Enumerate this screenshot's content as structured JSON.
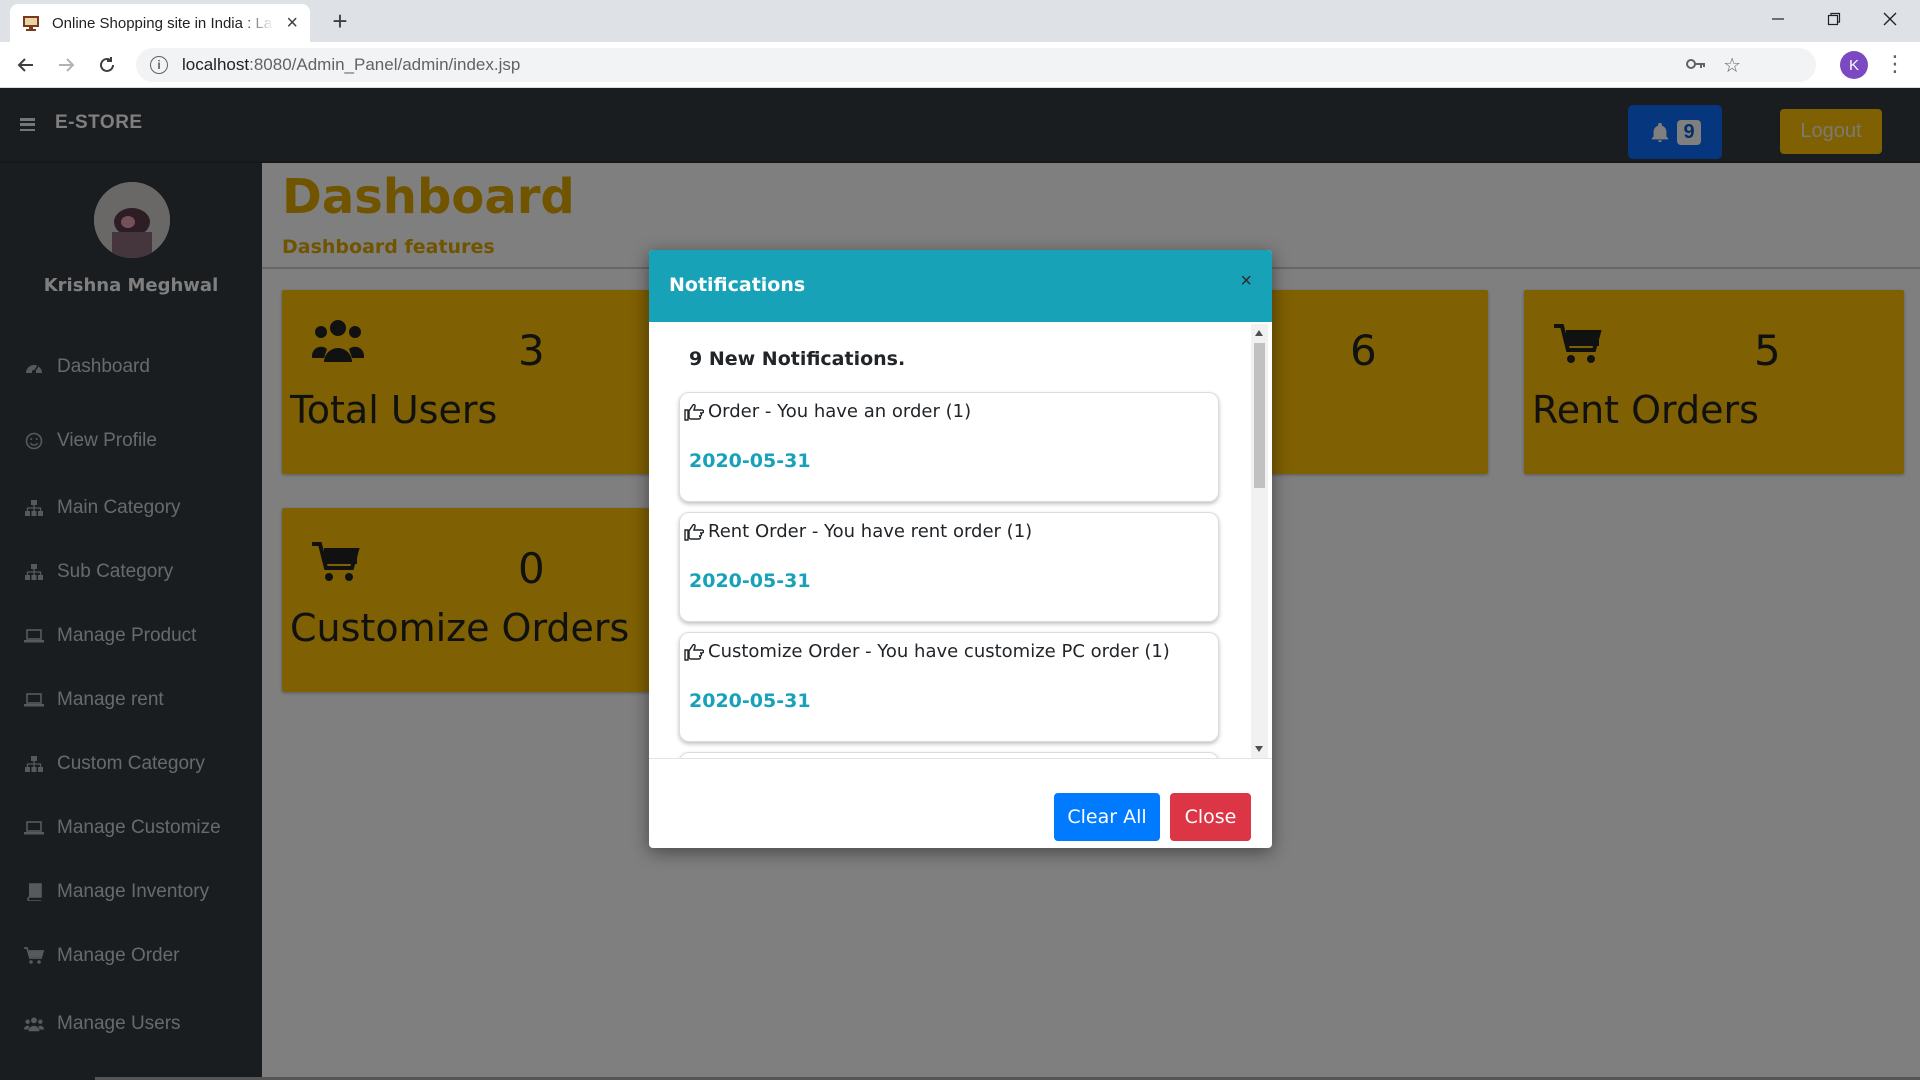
{
  "browser": {
    "tab_title": "Online Shopping site in India : La",
    "url_host": "localhost",
    "url_path": ":8080/Admin_Panel/admin/index.jsp",
    "profile_initial": "K"
  },
  "navbar": {
    "brand": "E-STORE",
    "notification_count": "9",
    "logout_label": "Logout"
  },
  "sidebar": {
    "user_name": "Krishna Meghwal",
    "items": [
      {
        "label": "Dashboard",
        "icon": "dashboard-icon"
      },
      {
        "label": "View Profile",
        "icon": "smile-icon"
      },
      {
        "label": "Main Category",
        "icon": "sitemap-icon"
      },
      {
        "label": "Sub Category",
        "icon": "sitemap-icon"
      },
      {
        "label": "Manage Product",
        "icon": "laptop-icon"
      },
      {
        "label": "Manage rent",
        "icon": "laptop-icon"
      },
      {
        "label": "Custom Category",
        "icon": "sitemap-icon"
      },
      {
        "label": "Manage Customize",
        "icon": "laptop-icon"
      },
      {
        "label": "Manage Inventory",
        "icon": "book-icon"
      },
      {
        "label": "Manage Order",
        "icon": "cart-icon"
      },
      {
        "label": "Manage Users",
        "icon": "users-icon"
      }
    ]
  },
  "dashboard": {
    "title": "Dashboard",
    "subtitle": "Dashboard features",
    "cards": [
      {
        "label": "Total Users",
        "count": "3",
        "icon": "users-icon"
      },
      {
        "label": "",
        "count": "6",
        "icon": ""
      },
      {
        "label": "Rent Orders",
        "count": "5",
        "icon": "cart-icon"
      },
      {
        "label": "Customize Orders",
        "count": "0",
        "icon": "cart-icon"
      }
    ]
  },
  "modal": {
    "title": "Notifications",
    "close_x": "×",
    "count_text": "9 New Notifications.",
    "notifications": [
      {
        "text": "Order - You have an order (1)",
        "date": "2020-05-31"
      },
      {
        "text": "Rent Order - You have rent order (1)",
        "date": "2020-05-31"
      },
      {
        "text": "Customize Order - You have customize PC order (1)",
        "date": "2020-05-31"
      }
    ],
    "clear_all_label": "Clear All",
    "close_label": "Close"
  },
  "colors": {
    "accent_yellow": "#ffc107",
    "info": "#17a2b8",
    "primary": "#007bff",
    "danger": "#dc3545",
    "dark": "#343a40"
  }
}
